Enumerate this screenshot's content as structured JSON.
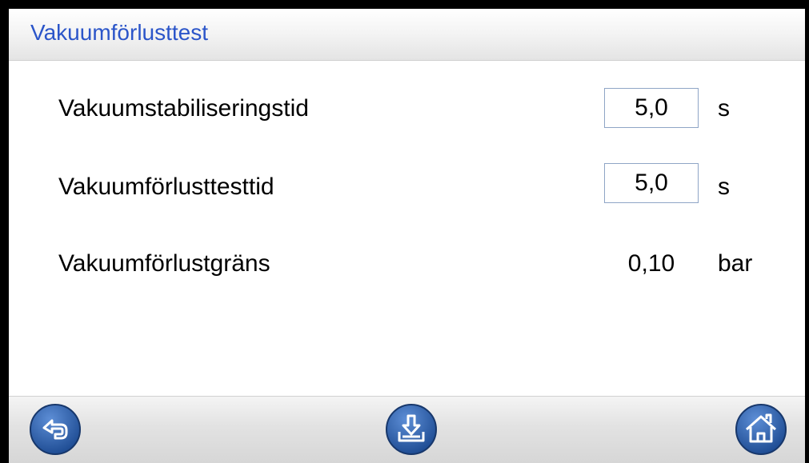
{
  "header": {
    "title": "Vakuumförlusttest"
  },
  "rows": [
    {
      "label": "Vakuumstabiliseringstid",
      "value": "5,0",
      "unit": "s",
      "editable": true
    },
    {
      "label": "Vakuumförlusttesttid",
      "value": "5,0",
      "unit": "s",
      "editable": true
    },
    {
      "label": "Vakuumförlustgräns",
      "value": "0,10",
      "unit": "bar",
      "editable": false
    }
  ],
  "footer": {
    "buttons": [
      {
        "icon": "back-arrow-icon"
      },
      {
        "icon": "save-download-icon"
      },
      {
        "icon": "home-icon"
      }
    ]
  },
  "colors": {
    "title": "#2b55c9",
    "button_fill": "#2f5fa8",
    "button_ring": "#1c3f7a",
    "field_border": "#8fa5c6"
  }
}
